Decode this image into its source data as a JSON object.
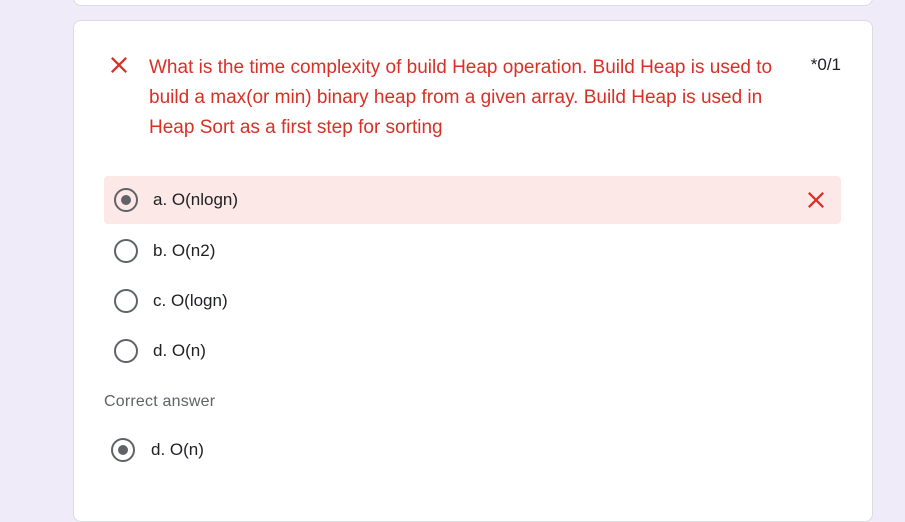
{
  "question": {
    "text": "What is the time complexity of build Heap operation. Build Heap is used to build a max(or min) binary heap from a given array. Build Heap is used in Heap Sort as a first step for sorting",
    "points": "*0/1",
    "status_icon": "close-icon",
    "status_color": "#d93025"
  },
  "options": [
    {
      "label": "a. O(nlogn)",
      "selected": true,
      "marked_wrong": true
    },
    {
      "label": "b. O(n2)",
      "selected": false,
      "marked_wrong": false
    },
    {
      "label": "c. O(logn)",
      "selected": false,
      "marked_wrong": false
    },
    {
      "label": "d. O(n)",
      "selected": false,
      "marked_wrong": false
    }
  ],
  "correct_answer": {
    "heading": "Correct answer",
    "label": "d. O(n)"
  },
  "colors": {
    "background": "#f0ebf8",
    "wrong_text": "#d93025",
    "wrong_row_bg": "#fce8e6",
    "radio": "#5f6368"
  }
}
